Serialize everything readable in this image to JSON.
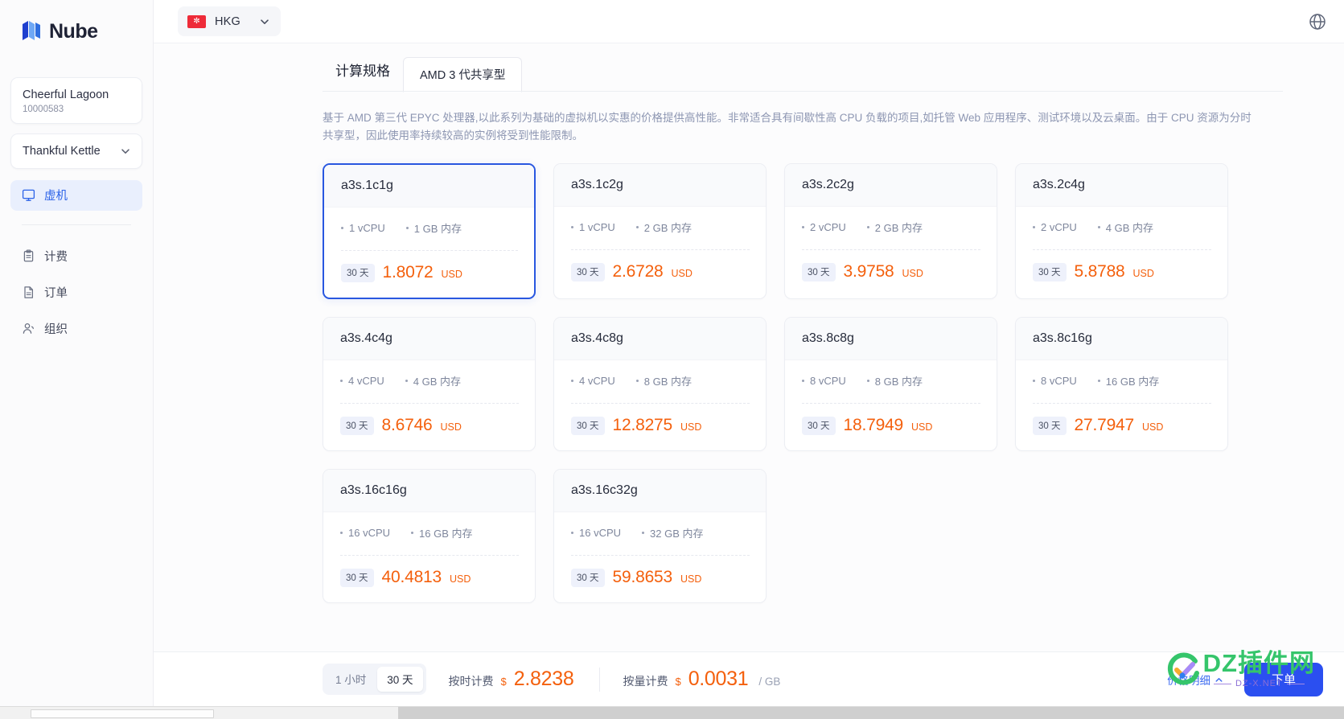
{
  "brand": {
    "name": "Nube",
    "logo_icon": "nube-logo-icon"
  },
  "sidebar": {
    "org": {
      "name": "Cheerful Lagoon",
      "id": "10000583"
    },
    "project": {
      "name": "Thankful Kettle",
      "chevron_icon": "chevron-down-icon"
    },
    "primary_nav": [
      {
        "label": "虚机",
        "icon": "monitor-icon",
        "active": true
      }
    ],
    "secondary_nav": [
      {
        "label": "计费",
        "icon": "clipboard-icon",
        "active": false
      },
      {
        "label": "订单",
        "icon": "document-icon",
        "active": false
      },
      {
        "label": "组织",
        "icon": "users-icon",
        "active": false
      }
    ]
  },
  "topbar": {
    "region": {
      "code": "HKG",
      "flag_icon": "hongkong-flag-icon",
      "chevron_icon": "chevron-down-icon"
    },
    "globe_icon": "globe-icon"
  },
  "main": {
    "tabs": [
      {
        "label": "计算规格",
        "active": false,
        "type": "section"
      },
      {
        "label": "AMD 3 代共享型",
        "active": true,
        "type": "sub"
      }
    ],
    "description": "基于 AMD 第三代 EPYC 处理器,以此系列为基础的虚拟机以实惠的价格提供高性能。非常适合具有间歇性高 CPU 负载的项目,如托管 Web 应用程序、测试环境以及云桌面。由于 CPU 资源为分时共享型，因此使用率持续较高的实例将受到性能限制。",
    "specs": [
      {
        "name": "a3s.1c1g",
        "vcpu": "1 vCPU",
        "memory": "1 GB 内存",
        "term": "30 天",
        "price": "1.8072",
        "currency": "USD",
        "selected": true
      },
      {
        "name": "a3s.1c2g",
        "vcpu": "1 vCPU",
        "memory": "2 GB 内存",
        "term": "30 天",
        "price": "2.6728",
        "currency": "USD",
        "selected": false
      },
      {
        "name": "a3s.2c2g",
        "vcpu": "2 vCPU",
        "memory": "2 GB 内存",
        "term": "30 天",
        "price": "3.9758",
        "currency": "USD",
        "selected": false
      },
      {
        "name": "a3s.2c4g",
        "vcpu": "2 vCPU",
        "memory": "4 GB 内存",
        "term": "30 天",
        "price": "5.8788",
        "currency": "USD",
        "selected": false
      },
      {
        "name": "a3s.4c4g",
        "vcpu": "4 vCPU",
        "memory": "4 GB 内存",
        "term": "30 天",
        "price": "8.6746",
        "currency": "USD",
        "selected": false
      },
      {
        "name": "a3s.4c8g",
        "vcpu": "4 vCPU",
        "memory": "8 GB 内存",
        "term": "30 天",
        "price": "12.8275",
        "currency": "USD",
        "selected": false
      },
      {
        "name": "a3s.8c8g",
        "vcpu": "8 vCPU",
        "memory": "8 GB 内存",
        "term": "30 天",
        "price": "18.7949",
        "currency": "USD",
        "selected": false
      },
      {
        "name": "a3s.8c16g",
        "vcpu": "8 vCPU",
        "memory": "16 GB 内存",
        "term": "30 天",
        "price": "27.7947",
        "currency": "USD",
        "selected": false
      },
      {
        "name": "a3s.16c16g",
        "vcpu": "16 vCPU",
        "memory": "16 GB 内存",
        "term": "30 天",
        "price": "40.4813",
        "currency": "USD",
        "selected": false
      },
      {
        "name": "a3s.16c32g",
        "vcpu": "16 vCPU",
        "memory": "32 GB 内存",
        "term": "30 天",
        "price": "59.8653",
        "currency": "USD",
        "selected": false
      }
    ]
  },
  "bottom_bar": {
    "term_options": [
      {
        "label": "1 小时",
        "selected": false
      },
      {
        "label": "30 天",
        "selected": true
      }
    ],
    "time_billing": {
      "label": "按时计费",
      "currency": "$",
      "amount": "2.8238"
    },
    "usage_billing": {
      "label": "按量计费",
      "currency": "$",
      "amount": "0.0031",
      "unit": "/ GB"
    },
    "price_detail_link": "价格明细",
    "price_detail_caret_icon": "chevron-up-icon",
    "order_button": "下单"
  },
  "watermark": {
    "main": "DZ插件网",
    "sub": "DZ-X.NET",
    "mark_icon": "dz-check-icon"
  },
  "colors": {
    "accent_blue": "#2b4ff0",
    "price_orange": "#f4600d",
    "nav_active_bg": "#e9effd",
    "nav_active_text": "#2b62e8",
    "flag_red": "#ee2b39",
    "watermark_green": "#35c56b"
  }
}
